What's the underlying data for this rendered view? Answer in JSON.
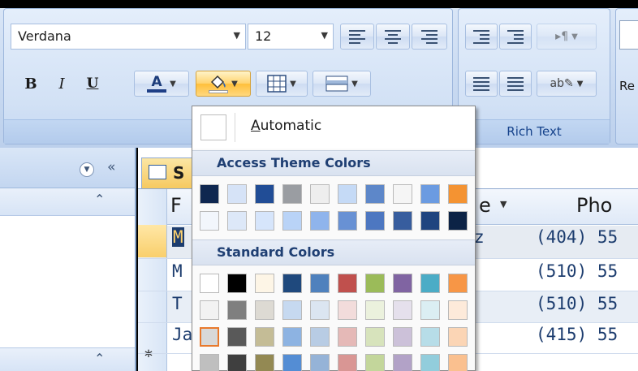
{
  "font_group": {
    "font_name": "Verdana",
    "font_size": "12",
    "bold_label": "B",
    "italic_label": "I",
    "underline_label": "U",
    "font_color_letter": "A"
  },
  "rich_text_group": {
    "caption": "Rich Text",
    "spacing_label": "ab",
    "next_group_label": "Re"
  },
  "sheet": {
    "header_text_1": "F",
    "header_text_2": "e",
    "header_phone": "Pho",
    "rows": [
      {
        "first": "M",
        "mid": "z",
        "phone": "(404) 55"
      },
      {
        "first": "M",
        "mid": "",
        "phone": "(510) 55"
      },
      {
        "first": "T",
        "mid": "",
        "phone": "(510) 55"
      },
      {
        "first": "Ja",
        "mid": "",
        "phone": "(415) 55"
      }
    ],
    "new_row_marker": "*",
    "tab_label": "S"
  },
  "color_menu": {
    "automatic_prefix": "",
    "automatic_underlined": "A",
    "automatic_rest": "utomatic",
    "theme_header": "Access Theme Colors",
    "standard_header": "Standard Colors",
    "theme_colors": [
      [
        "#0f2750",
        "#d6e3f7",
        "#214d96",
        "#9a9da2",
        "#eeeeee",
        "#c5daf6",
        "#5d87c9",
        "#f5f5f5",
        "#6b9be1",
        "#f49332"
      ],
      [
        "#f2f6fc",
        "#dde8f8",
        "#d6e5fb",
        "#b9d3f7",
        "#8fb4ec",
        "#6891d4",
        "#4d77c1",
        "#375d9e",
        "#1f447f",
        "#0c2346"
      ]
    ],
    "standard_colors": [
      [
        "#ffffff",
        "#000000",
        "#fdf5e6",
        "#1f497d",
        "#4f81bd",
        "#c0504d",
        "#9bbb59",
        "#8064a2",
        "#4bacc6",
        "#f79646"
      ],
      [
        "#f2f2f2",
        "#7f7f7f",
        "#dddad3",
        "#c6d9f0",
        "#dbe5f1",
        "#f2dcdb",
        "#ebf1dd",
        "#e5e0ec",
        "#dbeef3",
        "#fdeada"
      ],
      [
        "#d8d8d8",
        "#595959",
        "#c4bc96",
        "#8db3e2",
        "#b8cce4",
        "#e5b9b7",
        "#d7e3bc",
        "#ccc1d9",
        "#b7dde8",
        "#fbd5b5"
      ],
      [
        "#bfbfbf",
        "#3f3f3f",
        "#938953",
        "#548dd4",
        "#95b3d7",
        "#d99694",
        "#c3d69b",
        "#b2a2c7",
        "#92cddc",
        "#fac08f"
      ]
    ]
  }
}
